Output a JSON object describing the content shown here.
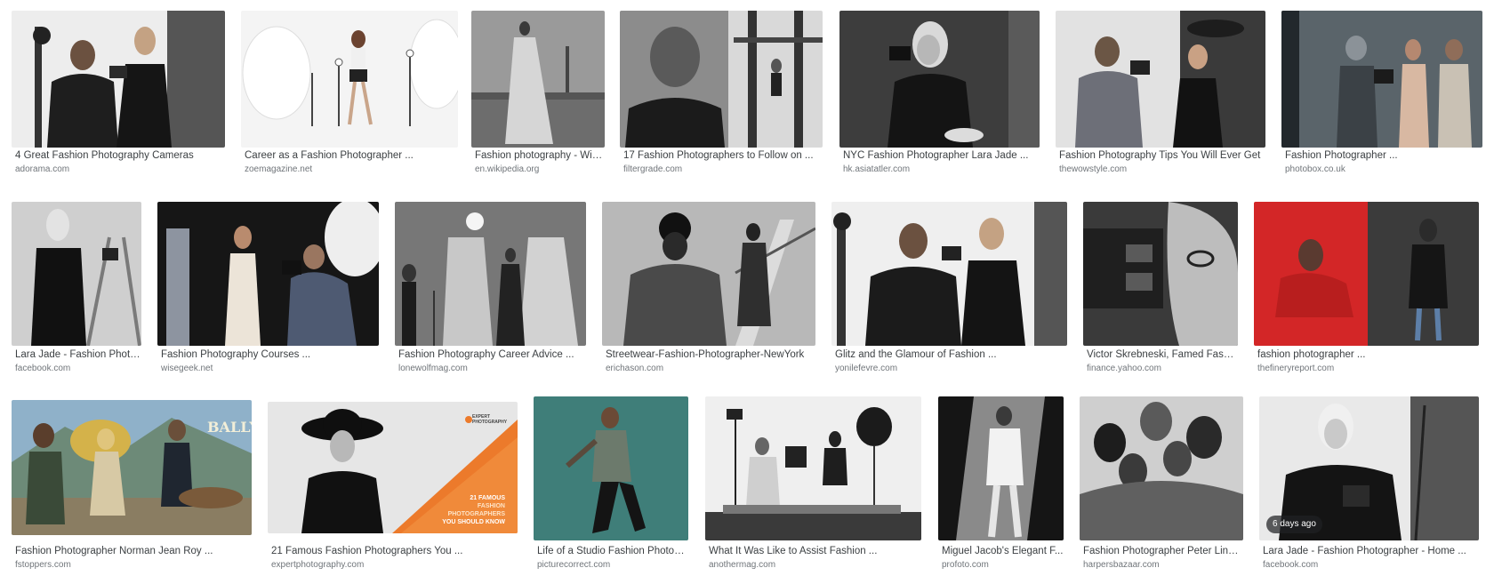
{
  "results": [
    {
      "title": "4 Great Fashion Photography Cameras",
      "source": "adorama.com",
      "icon": "photo-thumbnail"
    },
    {
      "title": "Career as a Fashion Photographer ...",
      "source": "zoemagazine.net",
      "icon": "photo-thumbnail"
    },
    {
      "title": "Fashion photography - Wiki...",
      "source": "en.wikipedia.org",
      "icon": "photo-thumbnail"
    },
    {
      "title": "17 Fashion Photographers to Follow on ...",
      "source": "filtergrade.com",
      "icon": "photo-thumbnail"
    },
    {
      "title": "NYC Fashion Photographer Lara Jade ...",
      "source": "hk.asiatatler.com",
      "icon": "photo-thumbnail"
    },
    {
      "title": "Fashion Photography Tips You Will Ever Get",
      "source": "thewowstyle.com",
      "icon": "photo-thumbnail"
    },
    {
      "title": "Fashion Photographer ...",
      "source": "photobox.co.uk",
      "icon": "photo-thumbnail"
    },
    {
      "title": "Lara Jade - Fashion Photo...",
      "source": "facebook.com",
      "icon": "photo-thumbnail"
    },
    {
      "title": "Fashion Photography Courses ...",
      "source": "wisegeek.net",
      "icon": "photo-thumbnail"
    },
    {
      "title": "Fashion Photography Career Advice ...",
      "source": "lonewolfmag.com",
      "icon": "photo-thumbnail"
    },
    {
      "title": "Streetwear-Fashion-Photographer-NewYork",
      "source": "erichason.com",
      "icon": "photo-thumbnail"
    },
    {
      "title": "Glitz and the Glamour of Fashion ...",
      "source": "yonilefevre.com",
      "icon": "photo-thumbnail"
    },
    {
      "title": "Victor Skrebneski, Famed Fashi...",
      "source": "finance.yahoo.com",
      "icon": "photo-thumbnail"
    },
    {
      "title": "fashion photographer ...",
      "source": "thefineryreport.com",
      "icon": "photo-thumbnail"
    },
    {
      "title": "Fashion Photographer Norman Jean Roy ...",
      "source": "fstoppers.com",
      "icon": "photo-thumbnail"
    },
    {
      "title": "21 Famous Fashion Photographers You ...",
      "source": "expertphotography.com",
      "icon": "photo-thumbnail",
      "overlay_brand": "EXPERT PHOTOGRAPHY",
      "overlay_lines": [
        "21 FAMOUS",
        "FASHION",
        "PHOTOGRAPHERS",
        "YOU SHOULD KNOW"
      ]
    },
    {
      "title": "Life of a Studio Fashion Photogr...",
      "source": "picturecorrect.com",
      "icon": "photo-thumbnail"
    },
    {
      "title": "What It Was Like to Assist Fashion ...",
      "source": "anothermag.com",
      "icon": "photo-thumbnail"
    },
    {
      "title": "Miguel Jacob's Elegant F...",
      "source": "profoto.com",
      "icon": "photo-thumbnail"
    },
    {
      "title": "Fashion Photographer Peter Lindb...",
      "source": "harpersbazaar.com",
      "icon": "photo-thumbnail"
    },
    {
      "title": "Lara Jade - Fashion Photographer - Home ...",
      "source": "facebook.com",
      "icon": "photo-thumbnail",
      "badge": "6 days ago"
    }
  ],
  "colors": {
    "caption": "#3c4043",
    "source": "#70757a",
    "background": "#ffffff"
  }
}
